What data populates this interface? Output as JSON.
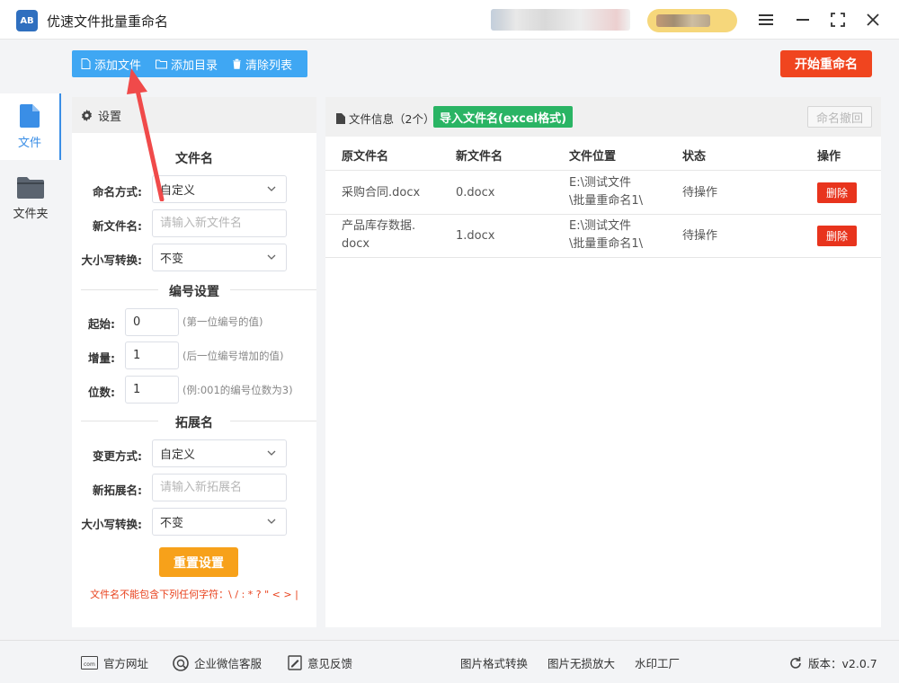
{
  "app": {
    "logo_text": "AB",
    "title": "优速文件批量重命名"
  },
  "toolbar": {
    "add_file": "添加文件",
    "add_folder": "添加目录",
    "clear_list": "清除列表",
    "start_rename": "开始重命名"
  },
  "nav": {
    "files": "文件",
    "folders": "文件夹"
  },
  "settings": {
    "header": "设置",
    "filename_section": "文件名",
    "naming_method_label": "命名方式:",
    "naming_method_value": "自定义",
    "new_name_label": "新文件名:",
    "new_name_placeholder": "请输入新文件名",
    "case_label": "大小写转换:",
    "case_value": "不变",
    "numbering_section": "编号设置",
    "start_label": "起始:",
    "start_value": "0",
    "start_hint": "(第一位编号的值)",
    "increment_label": "增量:",
    "increment_value": "1",
    "increment_hint": "(后一位编号增加的值)",
    "digits_label": "位数:",
    "digits_value": "1",
    "digits_hint": "(例:001的编号位数为3)",
    "extension_section": "拓展名",
    "ext_method_label": "变更方式:",
    "ext_method_value": "自定义",
    "new_ext_label": "新拓展名:",
    "new_ext_placeholder": "请输入新拓展名",
    "ext_case_label": "大小写转换:",
    "ext_case_value": "不变",
    "reset_button": "重置设置",
    "warning": "文件名不能包含下列任何字符：\\ / : * ? \" < > |"
  },
  "file_panel": {
    "title": "文件信息（2个）",
    "import_button": "导入文件名(excel格式)",
    "undo_button": "命名撤回",
    "columns": [
      "原文件名",
      "新文件名",
      "文件位置",
      "状态",
      "操作"
    ],
    "rows": [
      {
        "original_line1": "采购合同.docx",
        "original_line2": "",
        "new_name": "0.docx",
        "location_line1": "E:\\测试文件",
        "location_line2": "\\批量重命名1\\",
        "status": "待操作",
        "action": "删除"
      },
      {
        "original_line1": "产品库存数据.",
        "original_line2": "docx",
        "new_name": "1.docx",
        "location_line1": "E:\\测试文件",
        "location_line2": "\\批量重命名1\\",
        "status": "待操作",
        "action": "删除"
      }
    ]
  },
  "statusbar": {
    "website": "官方网址",
    "wechat_service": "企业微信客服",
    "feedback": "意见反馈",
    "image_convert": "图片格式转换",
    "image_upscale": "图片无损放大",
    "watermark": "水印工厂",
    "version": "版本：v2.0.7"
  },
  "colors": {
    "accent_blue": "#3fa7f3",
    "start_red": "#f0451f",
    "import_green": "#2ab464",
    "reset_orange": "#f7a11a",
    "delete_red": "#e8341d"
  }
}
